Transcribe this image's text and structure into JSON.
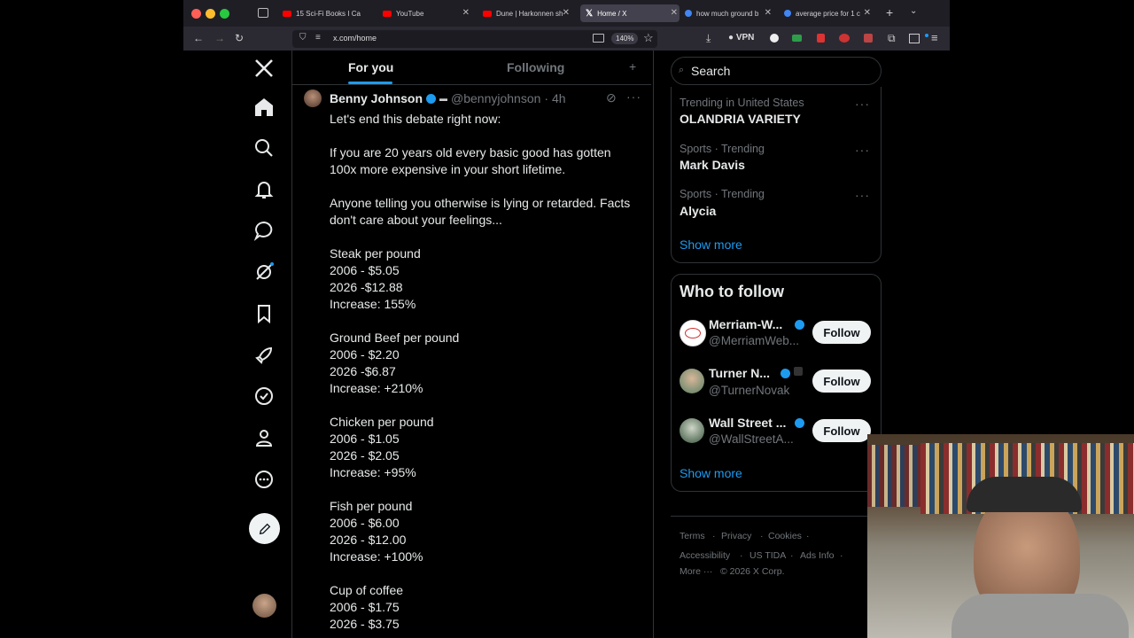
{
  "browser": {
    "tabs": [
      {
        "label": "15 Sci-Fi Books I Ca"
      },
      {
        "label": "YouTube"
      },
      {
        "label": "Dune | Harkonnen sh"
      },
      {
        "label": "Home / X"
      },
      {
        "label": "how much ground b"
      },
      {
        "label": "average price for 1 c"
      }
    ],
    "url": "x.com/home",
    "zoom": "140%",
    "vpn": "VPN"
  },
  "feed": {
    "tab_for_you": "For you",
    "tab_following": "Following",
    "tweet": {
      "author": "Benny Johnson",
      "handle": "@bennyjohnson",
      "time": "· 4h",
      "text": "Let's end this debate right now:\n\nIf you are 20 years old every basic good has gotten 100x more expensive in your short lifetime.\n\nAnyone telling you otherwise is lying or retarded. Facts don't care about your feelings...\n\nSteak per pound\n2006 - $5.05\n2026 -$12.88\nIncrease: 155%\n\nGround Beef per pound\n2006 - $2.20\n2026 -$6.87\nIncrease: +210%\n\nChicken per pound\n2006 - $1.05\n2026 - $2.05\nIncrease: +95%\n\nFish per pound\n2006 - $6.00\n2026 - $12.00\nIncrease: +100%\n\nCup of coffee\n2006 - $1.75\n2026 - $3.75"
    }
  },
  "sidebar": {
    "search_placeholder": "Search",
    "trends": [
      {
        "context": "Trending in United States",
        "name": "OLANDRIA VARIETY"
      },
      {
        "context": "Sports · Trending",
        "name": "Mark Davis"
      },
      {
        "context": "Sports · Trending",
        "name": "Alycia"
      }
    ],
    "trends_show_more": "Show more",
    "who_to_follow_title": "Who to follow",
    "who_to_follow": [
      {
        "name": "Merriam-W...",
        "handle": "@MerriamWeb...",
        "button": "Follow"
      },
      {
        "name": "Turner N...",
        "handle": "@TurnerNovak",
        "button": "Follow"
      },
      {
        "name": "Wall Street ...",
        "handle": "@WallStreetA...",
        "button": "Follow"
      }
    ],
    "wtf_show_more": "Show more",
    "footer": {
      "terms": "Terms",
      "privacy": "Privacy",
      "cookies": "Cookies",
      "accessibility": "Accessibility",
      "ustida": "US TIDA",
      "ads": "Ads Info",
      "more": "More ···",
      "copyright": "© 2026 X Corp."
    }
  },
  "colors": {
    "accent": "#1d9bf0",
    "background": "#000000",
    "text": "#e7e9ea",
    "muted": "#71767b"
  }
}
